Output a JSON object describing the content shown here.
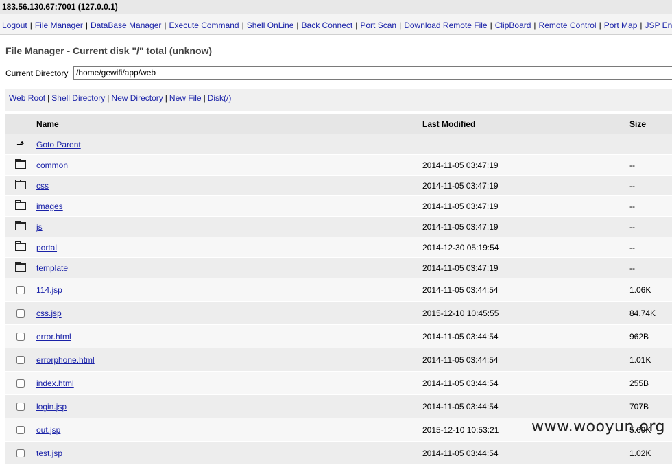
{
  "host": "183.56.130.67:7001 (127.0.0.1)",
  "menu": [
    "Logout",
    "File Manager",
    "DataBase Manager",
    "Execute Command",
    "Shell OnLine",
    "Back Connect",
    "Port Scan",
    "Download Remote File",
    "ClipBoard",
    "Remote Control",
    "Port Map",
    "JSP Env"
  ],
  "page_title": "File Manager - Current disk \"/\" total (unknow)",
  "cwd": {
    "label": "Current Directory",
    "value": "/home/gewifi/app/web"
  },
  "quick_links": [
    "Web Root",
    "Shell Directory",
    "New Directory",
    "New File",
    "Disk(/)"
  ],
  "table": {
    "headers": {
      "name": "Name",
      "modified": "Last Modified",
      "size": "Size"
    },
    "parent": "Goto Parent",
    "rows": [
      {
        "type": "dir",
        "name": "common",
        "modified": "2014-11-05 03:47:19",
        "size": "--"
      },
      {
        "type": "dir",
        "name": "css",
        "modified": "2014-11-05 03:47:19",
        "size": "--"
      },
      {
        "type": "dir",
        "name": "images",
        "modified": "2014-11-05 03:47:19",
        "size": "--"
      },
      {
        "type": "dir",
        "name": "js",
        "modified": "2014-11-05 03:47:19",
        "size": "--"
      },
      {
        "type": "dir",
        "name": "portal",
        "modified": "2014-12-30 05:19:54",
        "size": "--"
      },
      {
        "type": "dir",
        "name": "template",
        "modified": "2014-11-05 03:47:19",
        "size": "--"
      },
      {
        "type": "file",
        "name": "114.jsp",
        "modified": "2014-11-05 03:44:54",
        "size": "1.06K"
      },
      {
        "type": "file",
        "name": "css.jsp",
        "modified": "2015-12-10 10:45:55",
        "size": "84.74K"
      },
      {
        "type": "file",
        "name": "error.html",
        "modified": "2014-11-05 03:44:54",
        "size": "962B"
      },
      {
        "type": "file",
        "name": "errorphone.html",
        "modified": "2014-11-05 03:44:54",
        "size": "1.01K"
      },
      {
        "type": "file",
        "name": "index.html",
        "modified": "2014-11-05 03:44:54",
        "size": "255B"
      },
      {
        "type": "file",
        "name": "login.jsp",
        "modified": "2014-11-05 03:44:54",
        "size": "707B"
      },
      {
        "type": "file",
        "name": "out.jsp",
        "modified": "2015-12-10 10:53:21",
        "size": "5.69K"
      },
      {
        "type": "file",
        "name": "test.jsp",
        "modified": "2014-11-05 03:44:54",
        "size": "1.02K"
      }
    ]
  },
  "watermark": "www.wooyun.org"
}
